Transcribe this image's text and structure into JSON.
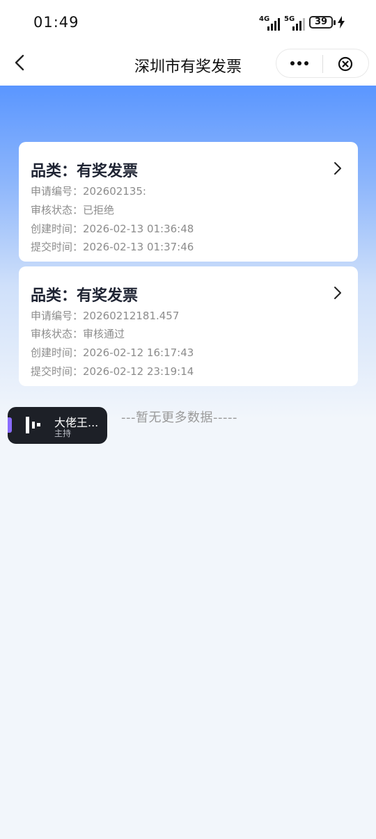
{
  "status_bar": {
    "time": "01:49",
    "signal_1_label": "4G",
    "signal_2_label": "5G",
    "battery": "39"
  },
  "nav": {
    "title": "深圳市有奖发票"
  },
  "records": [
    {
      "title": "品类：有奖发票",
      "fields": [
        {
          "key": "申请编号：",
          "value": "202602135:"
        },
        {
          "key": "审核状态：",
          "value": "已拒绝"
        },
        {
          "key": "创建时间：",
          "value": "2026-02-13 01:36:48"
        },
        {
          "key": "提交时间：",
          "value": "2026-02-13 01:37:46"
        }
      ]
    },
    {
      "title": "品类：有奖发票",
      "fields": [
        {
          "key": "申请编号：",
          "value": "20260212181.457"
        },
        {
          "key": "审核状态：",
          "value": "审核通过"
        },
        {
          "key": "创建时间：",
          "value": "2026-02-12 16:17:43"
        },
        {
          "key": "提交时间：",
          "value": "2026-02-12 23:19:14"
        }
      ]
    }
  ],
  "footer_text": "---暂无更多数据-----",
  "floating_player": {
    "name": "大佬王...",
    "role": "主持"
  },
  "colors": {
    "header_blue": "#5a96ff",
    "page_bg": "#f2f6fb",
    "player_accent": "#8a6cff"
  }
}
